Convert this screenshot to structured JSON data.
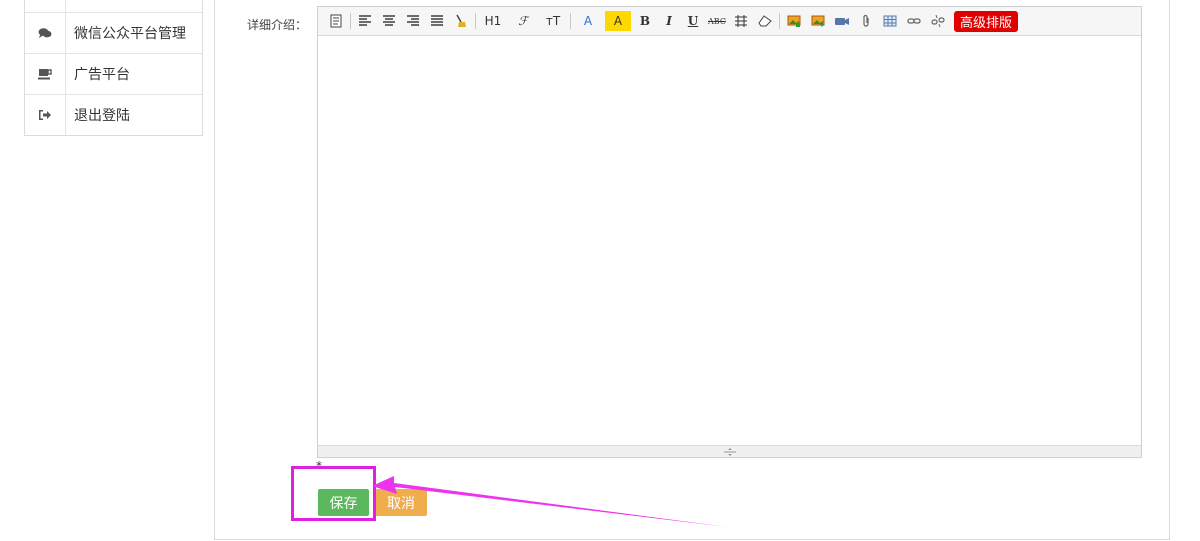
{
  "sidebar": {
    "items": [
      {
        "label": "",
        "icon": "menu-icon"
      },
      {
        "label": "微信公众平台管理",
        "icon": "comments-icon"
      },
      {
        "label": "广告平台",
        "icon": "coffee-icon"
      },
      {
        "label": "退出登陆",
        "icon": "sign-out-icon"
      }
    ]
  },
  "form": {
    "detail_label": "详细介绍：",
    "required_mark": "*",
    "save_label": "保存",
    "cancel_label": "取消"
  },
  "editor": {
    "toolbar": {
      "heading": "H1",
      "font_family": "ℱ",
      "font_size": "ᴛT",
      "font_color": "A",
      "highlight": "A",
      "bold": "B",
      "italic": "I",
      "underline": "U",
      "strike": "ABC",
      "advanced_label": "高级排版"
    },
    "content": ""
  },
  "colors": {
    "save": "#5cb85c",
    "cancel": "#f0ad4e",
    "annotation": "#e020e0",
    "advanced": "#e00000"
  }
}
